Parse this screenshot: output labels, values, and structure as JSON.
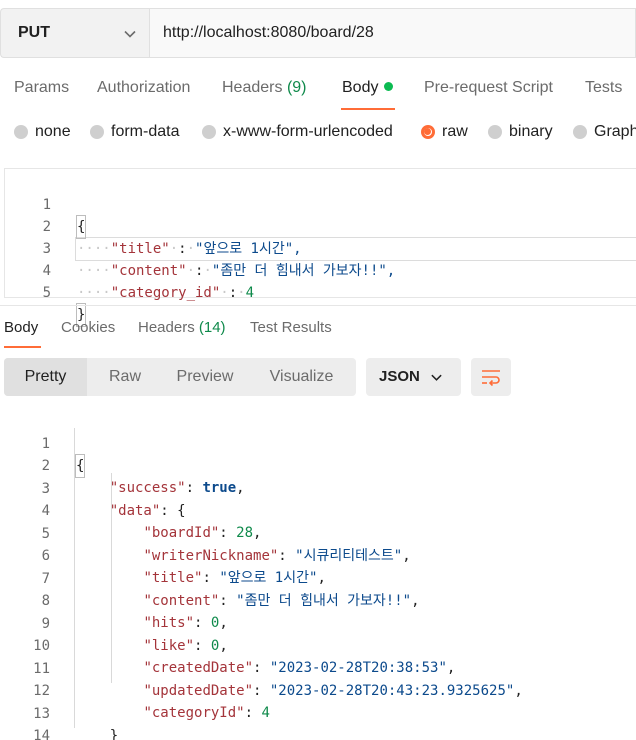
{
  "request": {
    "method": "PUT",
    "url": "http://localhost:8080/board/28"
  },
  "request_tabs": [
    {
      "label": "Params"
    },
    {
      "label": "Authorization"
    },
    {
      "label": "Headers",
      "count": "(9)"
    },
    {
      "label": "Body",
      "active": true,
      "dot": true
    },
    {
      "label": "Pre-request Script"
    },
    {
      "label": "Tests"
    }
  ],
  "body_types": [
    {
      "label": "none"
    },
    {
      "label": "form-data"
    },
    {
      "label": "x-www-form-urlencoded"
    },
    {
      "label": "raw",
      "selected": true
    },
    {
      "label": "binary"
    },
    {
      "label": "Graph"
    }
  ],
  "request_body": {
    "line_numbers": [
      "1",
      "2",
      "3",
      "4",
      "5"
    ],
    "open_brace": "{",
    "close_brace": "}",
    "fields": [
      {
        "key": "\"title\"",
        "value": "\"앞으로 1시간\","
      },
      {
        "key": "\"content\"",
        "value": "\"좀만 더 힘내서 가보자!!\","
      },
      {
        "key": "\"category_id\"",
        "value": "4"
      }
    ]
  },
  "response_tabs": [
    {
      "label": "Body",
      "active": true
    },
    {
      "label": "Cookies"
    },
    {
      "label": "Headers",
      "count": "(14)"
    },
    {
      "label": "Test Results"
    }
  ],
  "view_modes": [
    "Pretty",
    "Raw",
    "Preview",
    "Visualize"
  ],
  "format": "JSON",
  "response_body": {
    "line_numbers": [
      "1",
      "2",
      "3",
      "4",
      "5",
      "6",
      "7",
      "8",
      "9",
      "10",
      "11",
      "12",
      "13",
      "14"
    ],
    "open_brace": "{",
    "close_brace": "}",
    "success_key": "\"success\"",
    "success_value": "true",
    "data_key": "\"data\"",
    "data_open": "{",
    "data_close": "}",
    "data_fields": [
      {
        "key": "\"boardId\"",
        "value": "28",
        "type": "n",
        "comma": ","
      },
      {
        "key": "\"writerNickname\"",
        "value": "\"시큐리티테스트\"",
        "type": "s",
        "comma": ","
      },
      {
        "key": "\"title\"",
        "value": "\"앞으로 1시간\"",
        "type": "s",
        "comma": ","
      },
      {
        "key": "\"content\"",
        "value": "\"좀만 더 힘내서 가보자!!\"",
        "type": "s",
        "comma": ","
      },
      {
        "key": "\"hits\"",
        "value": "0",
        "type": "n",
        "comma": ","
      },
      {
        "key": "\"like\"",
        "value": "0",
        "type": "n",
        "comma": ","
      },
      {
        "key": "\"createdDate\"",
        "value": "\"2023-02-28T20:38:53\"",
        "type": "s",
        "comma": ","
      },
      {
        "key": "\"updatedDate\"",
        "value": "\"2023-02-28T20:43:23.9325625\"",
        "type": "s",
        "comma": ","
      },
      {
        "key": "\"categoryId\"",
        "value": "4",
        "type": "n",
        "comma": ""
      }
    ]
  },
  "colors": {
    "accent": "#ff6c37",
    "key": "#a4343a",
    "string": "#0c4a8c",
    "number": "#0f8a4b",
    "status_dot": "#0cbb52"
  },
  "icons": [
    "chevron-down-icon",
    "wrap-lines-icon"
  ]
}
